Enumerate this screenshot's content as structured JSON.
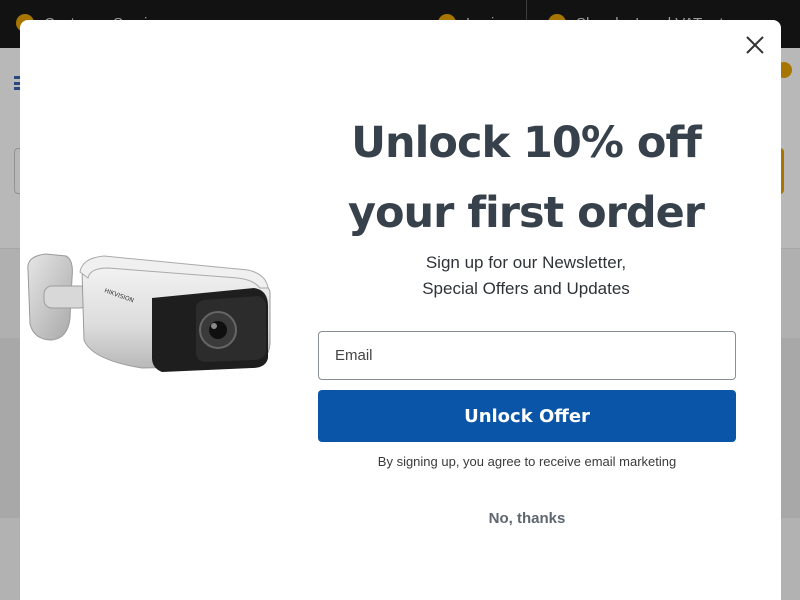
{
  "background": {
    "topbar": {
      "left_item": "Customer Service",
      "middle_item": "Login",
      "right_item": "Shop by Local VAT rate"
    }
  },
  "modal": {
    "headline_line1": "Unlock 10% off",
    "headline_line2": "your first order",
    "subhead_line1": "Sign up for our Newsletter,",
    "subhead_line2": "Special Offers and Updates",
    "email_placeholder": "Email",
    "email_value": "",
    "cta_label": "Unlock Offer",
    "disclaimer": "By signing up, you agree to receive email marketing",
    "dismiss_label": "No, thanks",
    "close_icon": "close-icon",
    "product_icon": "security-camera-image"
  },
  "colors": {
    "cta_background": "#0a55a8",
    "headline": "#37414b",
    "accent": "#e8a400"
  }
}
